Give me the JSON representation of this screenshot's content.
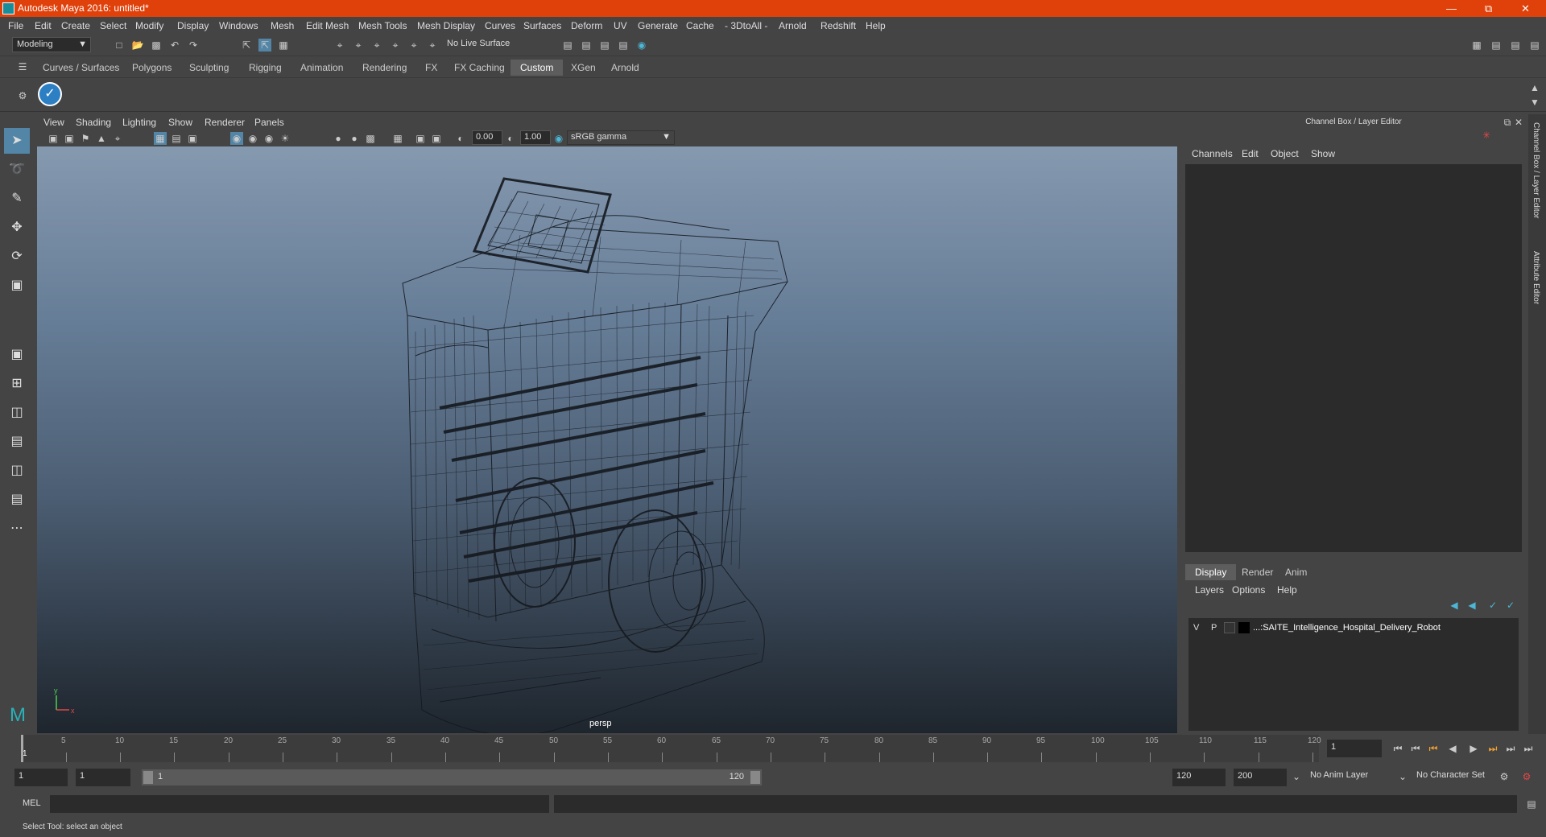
{
  "window": {
    "title": "Autodesk Maya 2016: untitled*"
  },
  "menubar": {
    "items": [
      "File",
      "Edit",
      "Create",
      "Select",
      "Modify",
      "Display",
      "Windows",
      "Mesh",
      "Edit Mesh",
      "Mesh Tools",
      "Mesh Display",
      "Curves",
      "Surfaces",
      "Deform",
      "UV",
      "Generate",
      "Cache",
      "- 3DtoAll -",
      "Arnold",
      "Redshift",
      "Help"
    ]
  },
  "statusline": {
    "mode": "Modeling",
    "live_surface": "No Live Surface"
  },
  "shelf": {
    "tabs": [
      "Curves / Surfaces",
      "Polygons",
      "Sculpting",
      "Rigging",
      "Animation",
      "Rendering",
      "FX",
      "FX Caching",
      "Custom",
      "XGen",
      "Arnold"
    ],
    "active_tab": "Custom"
  },
  "viewport": {
    "menu": [
      "View",
      "Shading",
      "Lighting",
      "Show",
      "Renderer",
      "Panels"
    ],
    "exposure": "0.00",
    "gamma": "1.00",
    "colorspace": "sRGB gamma",
    "camera_label": "persp",
    "axis_y": "y",
    "axis_x": "x"
  },
  "channelbox": {
    "title": "Channel Box / Layer Editor",
    "menu": [
      "Channels",
      "Edit",
      "Object",
      "Show"
    ]
  },
  "layereditor": {
    "tabs": [
      "Display",
      "Render",
      "Anim"
    ],
    "active_tab": "Display",
    "menu": [
      "Layers",
      "Options",
      "Help"
    ],
    "layer": {
      "v": "V",
      "p": "P",
      "name": "...:SAITE_Intelligence_Hospital_Delivery_Robot"
    }
  },
  "sidetabs": [
    "Channel Box / Layer Editor",
    "Attribute Editor"
  ],
  "timeline": {
    "ticks": [
      5,
      10,
      15,
      20,
      25,
      30,
      35,
      40,
      45,
      50,
      55,
      60,
      65,
      70,
      75,
      80,
      85,
      90,
      95,
      100,
      105,
      110,
      115,
      120
    ],
    "current_frame_marker": "1",
    "current_frame": "1"
  },
  "range": {
    "start": "1",
    "anim_start": "1",
    "slider_start": "1",
    "slider_end": "120",
    "anim_end": "120",
    "end": "200",
    "anim_layer": "No Anim Layer",
    "character_set": "No Character Set"
  },
  "mel": {
    "label": "MEL"
  },
  "helpline": {
    "text": "Select Tool: select an object"
  }
}
